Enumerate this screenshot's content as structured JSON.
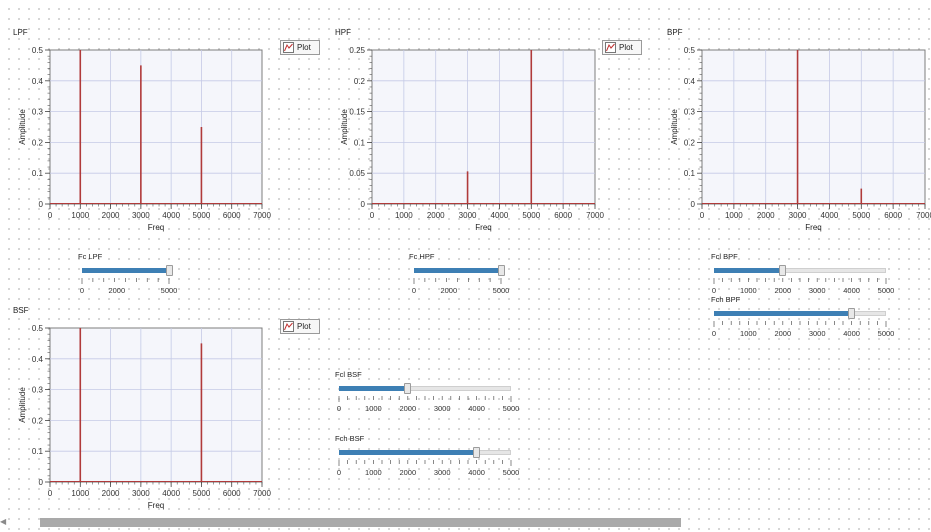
{
  "colors": {
    "plot_bg": "#f5f6fb",
    "grid": "#c5cae6",
    "signal": "#b03a3a",
    "slider_fill": "#3d7fb4"
  },
  "plot_button_label": "Plot",
  "panels": {
    "lpf": {
      "title": "LPF"
    },
    "hpf": {
      "title": "HPF"
    },
    "bpf": {
      "title": "BPF"
    },
    "bsf": {
      "title": "BSF"
    }
  },
  "chart_data": [
    {
      "id": "lpf",
      "type": "line",
      "title": "LPF",
      "xlabel": "Freq",
      "ylabel": "Amplitude",
      "xlim": [
        0,
        7000
      ],
      "ylim": [
        0,
        0.5
      ],
      "xticks": [
        0,
        1000,
        2000,
        3000,
        4000,
        5000,
        6000,
        7000
      ],
      "yticks": [
        0,
        0.1,
        0.2,
        0.3,
        0.4,
        0.5
      ],
      "ytick_labels": [
        "0",
        "0.1",
        "0.2",
        "0.3",
        "0.4",
        "0.5"
      ],
      "series": [
        {
          "x": [
            1000,
            3000,
            5000
          ],
          "y": [
            0.5,
            0.45,
            0.25
          ]
        }
      ]
    },
    {
      "id": "hpf",
      "type": "line",
      "title": "HPF",
      "xlabel": "Freq",
      "ylabel": "Amplitude",
      "xlim": [
        0,
        7000
      ],
      "ylim": [
        0,
        0.25
      ],
      "xticks": [
        0,
        1000,
        2000,
        3000,
        4000,
        5000,
        6000,
        7000
      ],
      "yticks": [
        0,
        0.05,
        0.1,
        0.15,
        0.2,
        0.25
      ],
      "ytick_labels": [
        "0",
        "0.05",
        "0.1",
        "0.15",
        "0.2",
        "0.25"
      ],
      "series": [
        {
          "x": [
            3000,
            5000
          ],
          "y": [
            0.053,
            0.25
          ]
        }
      ]
    },
    {
      "id": "bpf",
      "type": "line",
      "title": "BPF",
      "xlabel": "Freq",
      "ylabel": "Amplitude",
      "xlim": [
        0,
        7000
      ],
      "ylim": [
        0,
        0.5
      ],
      "xticks": [
        0,
        1000,
        2000,
        3000,
        4000,
        5000,
        6000,
        7000
      ],
      "yticks": [
        0,
        0.1,
        0.2,
        0.3,
        0.4,
        0.5
      ],
      "ytick_labels": [
        "0",
        "0.1",
        "0.2",
        "0.3",
        "0.4",
        "0.5"
      ],
      "series": [
        {
          "x": [
            3000,
            5000
          ],
          "y": [
            0.5,
            0.05
          ]
        }
      ]
    },
    {
      "id": "bsf",
      "type": "line",
      "title": "BSF",
      "xlabel": "Freq",
      "ylabel": "Amplitude",
      "xlim": [
        0,
        7000
      ],
      "ylim": [
        0,
        0.5
      ],
      "xticks": [
        0,
        1000,
        2000,
        3000,
        4000,
        5000,
        6000,
        7000
      ],
      "yticks": [
        0,
        0.1,
        0.2,
        0.3,
        0.4,
        0.5
      ],
      "ytick_labels": [
        "0",
        "0.1",
        "0.2",
        "0.3",
        "0.4",
        "0.5"
      ],
      "series": [
        {
          "x": [
            1000,
            5000
          ],
          "y": [
            0.5,
            0.45
          ]
        }
      ]
    }
  ],
  "sliders": {
    "fc_lpf": {
      "label": "Fc LPF",
      "min": 0,
      "max": 5000,
      "value": 5000,
      "tick_labels": [
        0,
        2000,
        5000
      ]
    },
    "fc_hpf": {
      "label": "Fc HPF",
      "min": 0,
      "max": 5000,
      "value": 5000,
      "tick_labels": [
        0,
        2000,
        5000
      ]
    },
    "fcl_bpf": {
      "label": "Fcl BPF",
      "min": 0,
      "max": 5000,
      "value": 2000,
      "tick_labels": [
        0,
        1000,
        2000,
        3000,
        4000,
        5000
      ]
    },
    "fch_bpf": {
      "label": "Fch BPF",
      "min": 0,
      "max": 5000,
      "value": 4000,
      "tick_labels": [
        0,
        1000,
        2000,
        3000,
        4000,
        5000
      ]
    },
    "fcl_bsf": {
      "label": "Fcl BSF",
      "min": 0,
      "max": 5000,
      "value": 2000,
      "tick_labels": [
        0,
        1000,
        2000,
        3000,
        4000,
        5000
      ]
    },
    "fch_bsf": {
      "label": "Fch BSF",
      "min": 0,
      "max": 5000,
      "value": 4000,
      "tick_labels": [
        0,
        1000,
        2000,
        3000,
        4000,
        5000
      ]
    }
  },
  "scrollbar": {
    "arrow": "◀"
  }
}
